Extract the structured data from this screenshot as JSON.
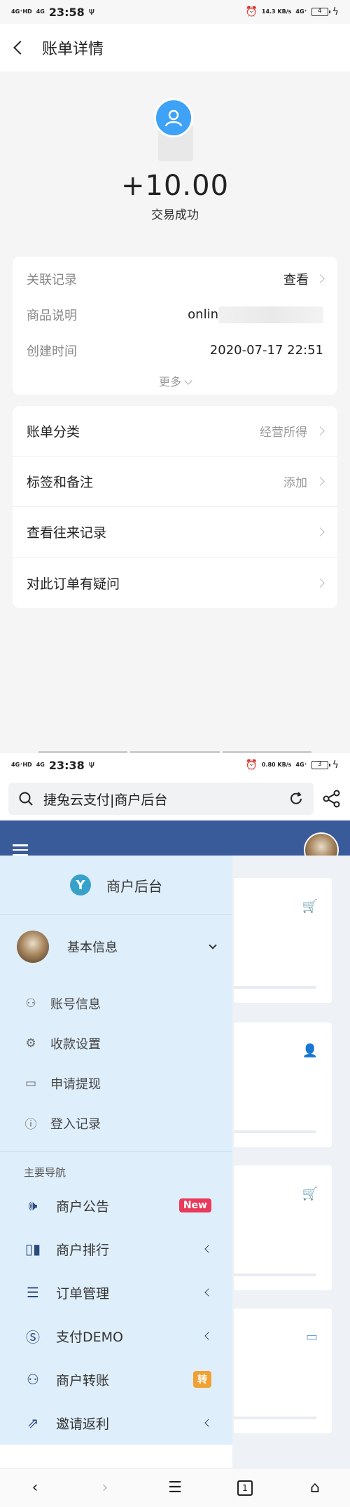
{
  "screen1": {
    "status": {
      "net1": "4G⁺HD",
      "net2": "4G",
      "time": "23:58",
      "usb": "ᴪ",
      "speed": "14.3 KB/s",
      "net3": "4G⁺",
      "battery": "4"
    },
    "nav": {
      "title": "账单详情"
    },
    "amount": "+10.00",
    "status_text": "交易成功",
    "details": [
      {
        "label": "关联记录",
        "value": "查看"
      },
      {
        "label": "商品说明",
        "value": "onlin"
      },
      {
        "label": "创建时间",
        "value": "2020-07-17 22:51"
      }
    ],
    "more": "更多",
    "actions": [
      {
        "label": "账单分类",
        "value": "经营所得"
      },
      {
        "label": "标签和备注",
        "value": "添加"
      },
      {
        "label": "查看往来记录",
        "value": ""
      },
      {
        "label": "对此订单有疑问",
        "value": ""
      }
    ]
  },
  "screen2": {
    "status": {
      "net1": "4G⁺HD",
      "net2": "4G",
      "time": "23:38",
      "usb": "ᴪ",
      "speed": "0.80 KB/s",
      "net3": "4G⁺",
      "battery": "3"
    },
    "address": "捷兔云支付|商户后台",
    "drawer": {
      "title": "商户后台",
      "logo_letter": "Y",
      "profile": "基本信息",
      "sub_items": [
        {
          "label": "账号信息",
          "icon": "user-icon"
        },
        {
          "label": "收款设置",
          "icon": "gear-icon"
        },
        {
          "label": "申请提现",
          "icon": "folder-icon"
        },
        {
          "label": "登入记录",
          "icon": "info-icon"
        }
      ],
      "section": "主要导航",
      "nav": [
        {
          "label": "商户公告",
          "icon": "speaker-icon",
          "badge": "New"
        },
        {
          "label": "商户排行",
          "icon": "bar-chart-icon"
        },
        {
          "label": "订单管理",
          "icon": "list-icon"
        },
        {
          "label": "支付DEMO",
          "icon": "skype-icon"
        },
        {
          "label": "商户转账",
          "icon": "users-icon",
          "badge": "转"
        },
        {
          "label": "邀请返利",
          "icon": "share-icon"
        }
      ]
    },
    "bottom": {
      "tabs_count": "1"
    }
  }
}
